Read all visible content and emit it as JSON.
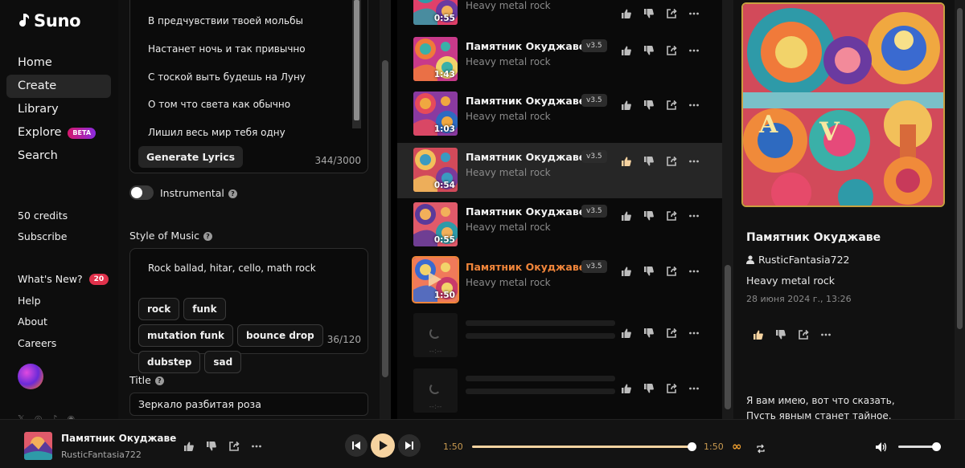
{
  "brand": {
    "name": "Suno"
  },
  "sidebar": {
    "nav": [
      {
        "label": "Home"
      },
      {
        "label": "Create",
        "active": true
      },
      {
        "label": "Library"
      },
      {
        "label": "Explore",
        "badge": "BETA"
      },
      {
        "label": "Search"
      }
    ],
    "credits": "50 credits",
    "subscribe": "Subscribe",
    "whats_new": "What's New?",
    "whats_new_count": "20",
    "help": "Help",
    "about": "About",
    "careers": "Careers",
    "socials": [
      "x-icon",
      "instagram-icon",
      "tiktok-icon",
      "discord-icon"
    ]
  },
  "create": {
    "lyrics": [
      "В предчувствии твоей мольбы",
      "Настанет ночь и так привычно",
      "С тоской выть будешь на Луну",
      "О том что света как обычно",
      "Лишил весь мир тебя одну"
    ],
    "generate_lyrics": "Generate Lyrics",
    "lyrics_count": "344/3000",
    "instrumental": "Instrumental",
    "instrumental_on": false,
    "style_label": "Style of Music",
    "style_value": "Rock ballad, hitar, cello, math rock",
    "tags": [
      "rock",
      "funk",
      "mutation funk",
      "bounce drop",
      "dubstep",
      "sad"
    ],
    "style_count": "36/120",
    "title_label": "Title",
    "title_value": "Зеркало разбитая роза"
  },
  "tracks": [
    {
      "title": "",
      "genre": "Heavy metal rock",
      "duration": "0:55",
      "version": ""
    },
    {
      "title": "Памятник Окуджаве",
      "genre": "Heavy metal rock",
      "duration": "1:43",
      "version": "v3.5"
    },
    {
      "title": "Памятник Окуджаве",
      "genre": "Heavy metal rock",
      "duration": "1:03",
      "version": "v3.5"
    },
    {
      "title": "Памятник Окуджаве",
      "genre": "Heavy metal rock",
      "duration": "0:54",
      "version": "v3.5",
      "highlighted": true,
      "liked": true
    },
    {
      "title": "Памятник Окуджаве",
      "genre": "Heavy metal rock",
      "duration": "0:55",
      "version": "v3.5"
    },
    {
      "title": "Памятник Окуджаве",
      "genre": "Heavy metal rock",
      "duration": "1:50",
      "version": "v3.5",
      "playing": true
    },
    {
      "placeholder": true,
      "duration": "--:--"
    },
    {
      "placeholder": true,
      "duration": "--:--"
    }
  ],
  "detail": {
    "title": "Памятник Окуджаве",
    "author": "RusticFantasia722",
    "genre": "Heavy metal rock",
    "date": "28 июня 2024 г., 13:26",
    "lyrics": [
      "Я вам имею, вот что сказать,",
      "Пусть явным станет тайное."
    ]
  },
  "player": {
    "title": "Памятник Окуджаве",
    "author": "RusticFantasia722",
    "time_current": "1:50",
    "time_total": "1:50",
    "progress": 1.0,
    "volume": 1.0
  },
  "colors": {
    "accent": "#f0853a",
    "play_button": "#f6d3a0",
    "beta_badge": "#b01fb8",
    "new_badge": "#e0314b"
  }
}
